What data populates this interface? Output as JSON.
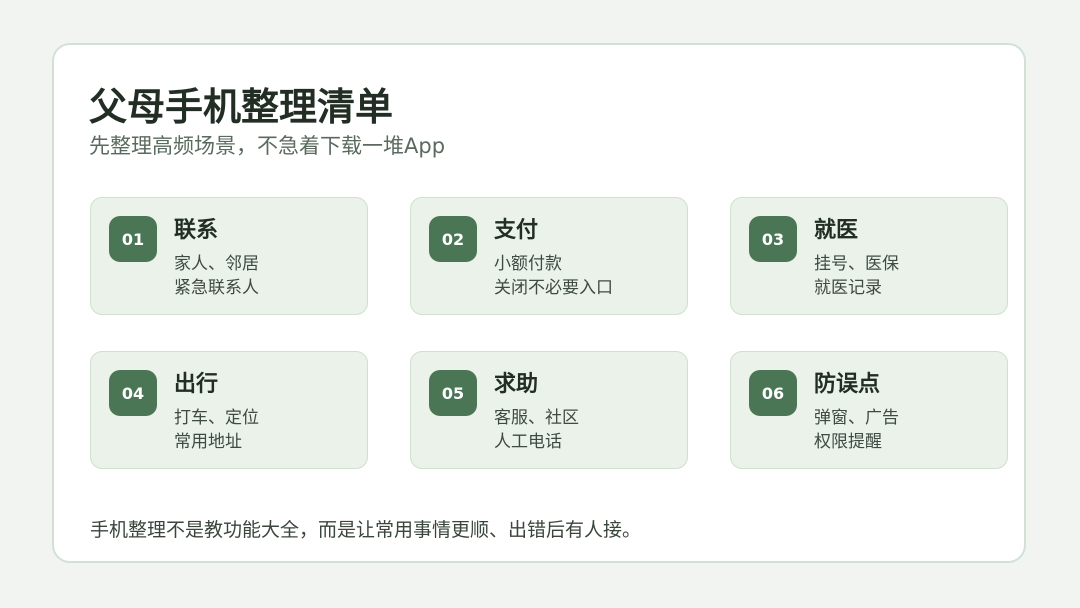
{
  "header": {
    "title": "父母手机整理清单",
    "subtitle": "先整理高频场景，不急着下载一堆App"
  },
  "cards": [
    {
      "number": "01",
      "title": "联系",
      "lines": [
        "家人、邻居",
        "紧急联系人"
      ]
    },
    {
      "number": "02",
      "title": "支付",
      "lines": [
        "小额付款",
        "关闭不必要入口"
      ]
    },
    {
      "number": "03",
      "title": "就医",
      "lines": [
        "挂号、医保",
        "就医记录"
      ]
    },
    {
      "number": "04",
      "title": "出行",
      "lines": [
        "打车、定位",
        "常用地址"
      ]
    },
    {
      "number": "05",
      "title": "求助",
      "lines": [
        "客服、社区",
        "人工电话"
      ]
    },
    {
      "number": "06",
      "title": "防误点",
      "lines": [
        "弹窗、广告",
        "权限提醒"
      ]
    }
  ],
  "footer": {
    "text": "手机整理不是教功能大全，而是让常用事情更顺、出错后有人接。"
  },
  "colors": {
    "background": "#f1f4f1",
    "panel": "#ffffff",
    "card": "#eaf2ea",
    "badge": "#4a7656",
    "title": "#222d24"
  }
}
